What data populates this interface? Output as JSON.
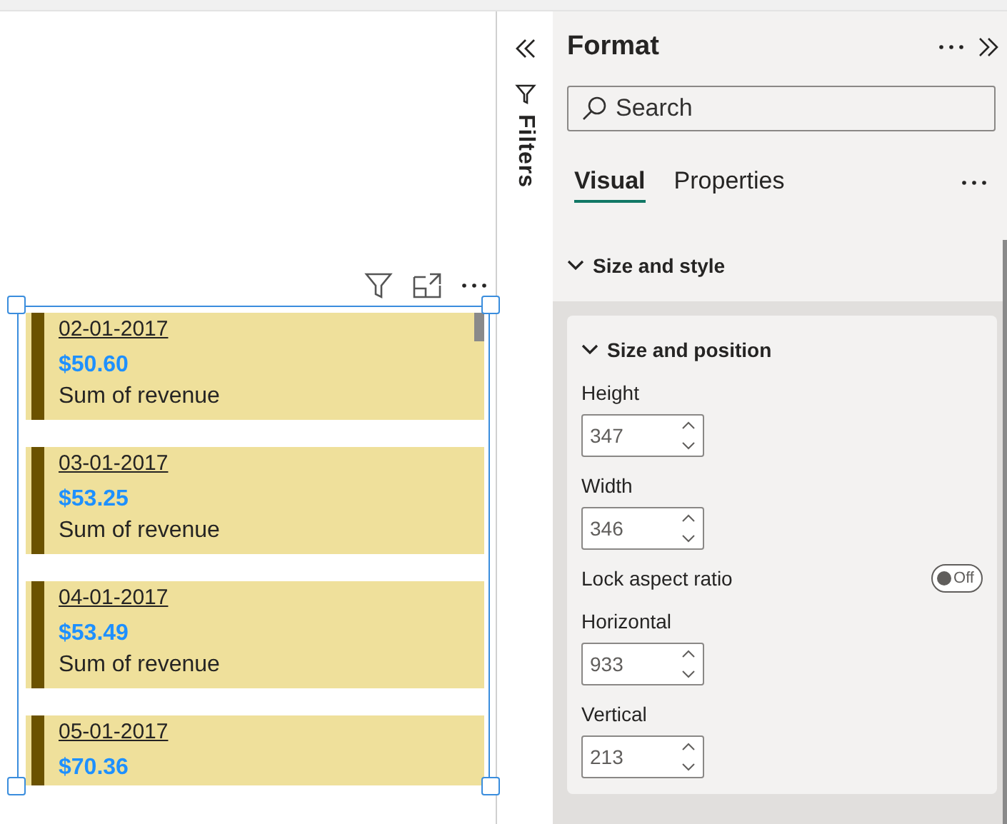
{
  "visual": {
    "cards": [
      {
        "date": "02-01-2017",
        "value": "$50.60",
        "label": "Sum of revenue"
      },
      {
        "date": "03-01-2017",
        "value": "$53.25",
        "label": "Sum of revenue"
      },
      {
        "date": "04-01-2017",
        "value": "$53.49",
        "label": "Sum of revenue"
      },
      {
        "date": "05-01-2017",
        "value": "$70.36"
      }
    ]
  },
  "filters_pane": {
    "label": "Filters"
  },
  "format_pane": {
    "title": "Format",
    "search": {
      "placeholder": "Search"
    },
    "tabs": [
      {
        "label": "Visual",
        "selected": true
      },
      {
        "label": "Properties",
        "selected": false
      }
    ],
    "section": {
      "title": "Size and style",
      "expanded": true,
      "group": {
        "title": "Size and position",
        "expanded": true,
        "fields": [
          {
            "kind": "number",
            "label": "Height",
            "value": "347"
          },
          {
            "kind": "number",
            "label": "Width",
            "value": "346"
          },
          {
            "kind": "toggle",
            "label": "Lock aspect ratio",
            "on": false,
            "state_text": "Off"
          },
          {
            "kind": "number",
            "label": "Horizontal",
            "value": "933"
          },
          {
            "kind": "number",
            "label": "Vertical",
            "value": "213"
          }
        ]
      }
    }
  }
}
